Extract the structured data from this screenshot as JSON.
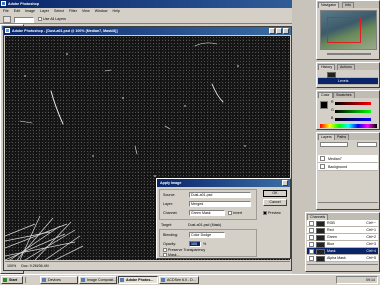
{
  "app": {
    "title": "Adobe Photoshop",
    "doc_title": "Adobe Photoshop - [Dust-a01.psd @ 100% (Median7, Mask/8)]"
  },
  "menu": [
    "File",
    "Edit",
    "Image",
    "Layer",
    "Select",
    "Filter",
    "View",
    "Window",
    "Help"
  ],
  "options_bar": {
    "field": "",
    "checkbox": "Use All Layers"
  },
  "status": {
    "zoom": "100%",
    "doc": "Doc: 9.2M/36.4M"
  },
  "navigator": {
    "tabs": [
      "Navigator",
      "Info"
    ]
  },
  "history": {
    "tabs": [
      "History",
      "Actions"
    ],
    "items": [
      "",
      "Levels"
    ]
  },
  "color": {
    "tabs": [
      "Color",
      "Swatches"
    ],
    "channels": [
      "R",
      "G",
      "B"
    ]
  },
  "layers": {
    "tabs": [
      "Layers",
      "Paths"
    ],
    "items": [
      "Median7",
      "Background"
    ]
  },
  "channels": {
    "tabs": [
      "Channels"
    ],
    "items": [
      {
        "name": "RGB",
        "kb": "Ctrl+~"
      },
      {
        "name": "Red",
        "kb": "Ctrl+1"
      },
      {
        "name": "Green",
        "kb": "Ctrl+2"
      },
      {
        "name": "Blue",
        "kb": "Ctrl+3"
      },
      {
        "name": "Mask",
        "kb": "Ctrl+4"
      },
      {
        "name": "Alpha Mask",
        "kb": "Ctrl+5"
      }
    ]
  },
  "dialog": {
    "title": "Apply Image",
    "source_label": "Source:",
    "source": "Dust-a01.psd",
    "layer_label": "Layer:",
    "layer": "Merged",
    "channel_label": "Channel:",
    "channel": "Green Mask",
    "invert": "Invert",
    "target_label": "Target:",
    "target": "Dust-a01.psd (Mask)",
    "blending_label": "Blending:",
    "blending": "Color Dodge",
    "opacity_label": "Opacity:",
    "opacity": "100",
    "opacity_unit": "%",
    "preserve": "Preserve Transparency",
    "mask": "Mask...",
    "ok": "OK",
    "cancel": "Cancel",
    "preview": "Preview"
  },
  "taskbar": {
    "start": "Start",
    "tasks": [
      "Devices",
      "Image Composit...",
      "Adobe Photos...",
      "ACDSee 6.0 - D..."
    ],
    "clock": "09:14"
  }
}
